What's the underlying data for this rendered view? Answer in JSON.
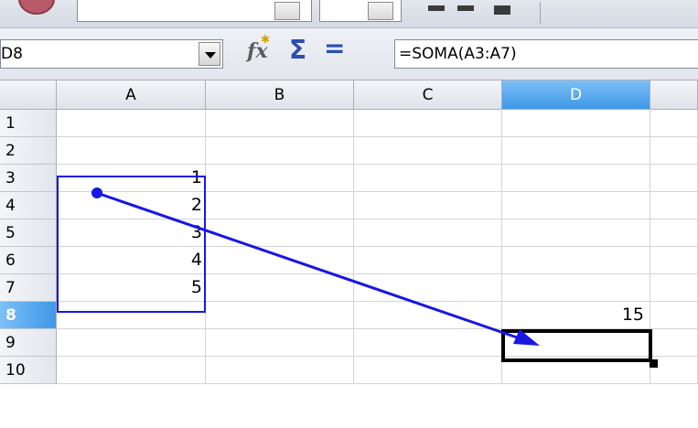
{
  "name_box": {
    "value": "D8"
  },
  "toolbar": {
    "function_wizard_icon": "fx-icon",
    "sum_icon": "sigma-icon",
    "formula_icon": "equals-icon"
  },
  "formula_bar": {
    "content": "=SOMA(A3:A7)"
  },
  "sheet": {
    "columns": [
      "A",
      "B",
      "C",
      "D"
    ],
    "rows": [
      "1",
      "2",
      "3",
      "4",
      "5",
      "6",
      "7",
      "8",
      "9",
      "10"
    ],
    "selected_column": "D",
    "selected_row": "8",
    "cells": {
      "A3": "1",
      "A4": "2",
      "A5": "3",
      "A6": "4",
      "A7": "5",
      "D8": "15"
    }
  },
  "colors": {
    "range_border": "#1717e6",
    "trace_arrow": "#1717e6",
    "header_highlight": "#3f98e8"
  }
}
